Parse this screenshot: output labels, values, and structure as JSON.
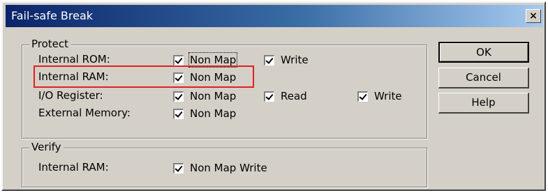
{
  "window": {
    "title": "Fail-safe Break",
    "close_label": "×"
  },
  "protect": {
    "label": "Protect",
    "rows": [
      {
        "label": "Internal ROM:",
        "non_map": "Non Map",
        "write": "Write"
      },
      {
        "label": "Internal RAM:",
        "non_map": "Non Map"
      },
      {
        "label": "I/O Register:",
        "non_map": "Non Map",
        "read": "Read",
        "write": "Write"
      },
      {
        "label": "External Memory:",
        "non_map": "Non Map"
      }
    ]
  },
  "verify": {
    "label": "Verify",
    "row": {
      "label": "Internal RAM:",
      "option": "Non Map Write"
    }
  },
  "buttons": {
    "ok": "OK",
    "cancel": "Cancel",
    "help": "Help"
  },
  "checked": {
    "rom_non_map": true,
    "rom_write": true,
    "ram_non_map": true,
    "io_non_map": true,
    "io_read": true,
    "io_write": true,
    "ext_non_map": true,
    "verify_non_map_write": true
  },
  "colors": {
    "highlight": "#e02020",
    "titlebar_start": "#0a246a",
    "titlebar_end": "#a6caf0",
    "face": "#d4d0c8"
  }
}
